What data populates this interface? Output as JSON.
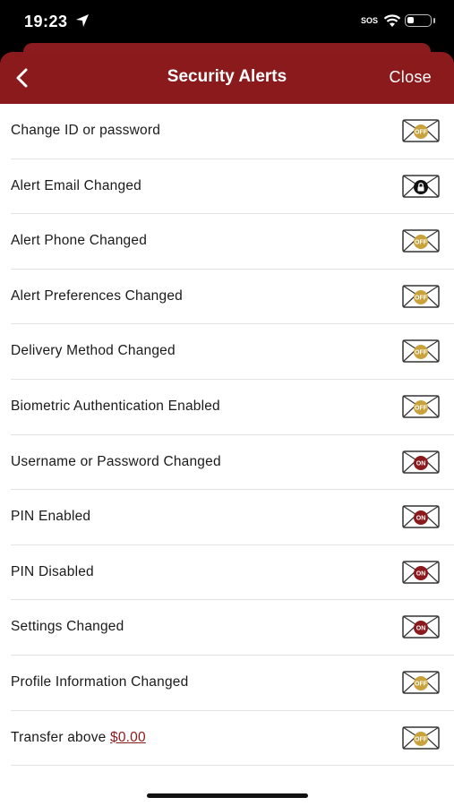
{
  "status": {
    "time": "19:23",
    "sos": "SOS"
  },
  "header": {
    "title": "Security Alerts",
    "close_label": "Close"
  },
  "colors": {
    "brand": "#8b1a1c",
    "off": "#c9a23c",
    "on": "#8b1a1c",
    "locked": "#111111"
  },
  "alerts": [
    {
      "label": "Change ID or password",
      "state": "off",
      "badge": "OFF"
    },
    {
      "label": "Alert Email Changed",
      "state": "locked",
      "badge": ""
    },
    {
      "label": "Alert Phone Changed",
      "state": "off",
      "badge": "OFF"
    },
    {
      "label": "Alert Preferences Changed",
      "state": "off",
      "badge": "OFF"
    },
    {
      "label": "Delivery Method Changed",
      "state": "off",
      "badge": "OFF"
    },
    {
      "label": "Biometric Authentication Enabled",
      "state": "off",
      "badge": "OFF"
    },
    {
      "label": "Username or Password Changed",
      "state": "on",
      "badge": "ON"
    },
    {
      "label": "PIN Enabled",
      "state": "on",
      "badge": "ON"
    },
    {
      "label": "PIN Disabled",
      "state": "on",
      "badge": "ON"
    },
    {
      "label": "Settings Changed",
      "state": "on",
      "badge": "ON"
    },
    {
      "label": "Profile Information Changed",
      "state": "off",
      "badge": "OFF"
    },
    {
      "label": "Transfer above",
      "link": "$0.00",
      "state": "off",
      "badge": "OFF"
    }
  ]
}
